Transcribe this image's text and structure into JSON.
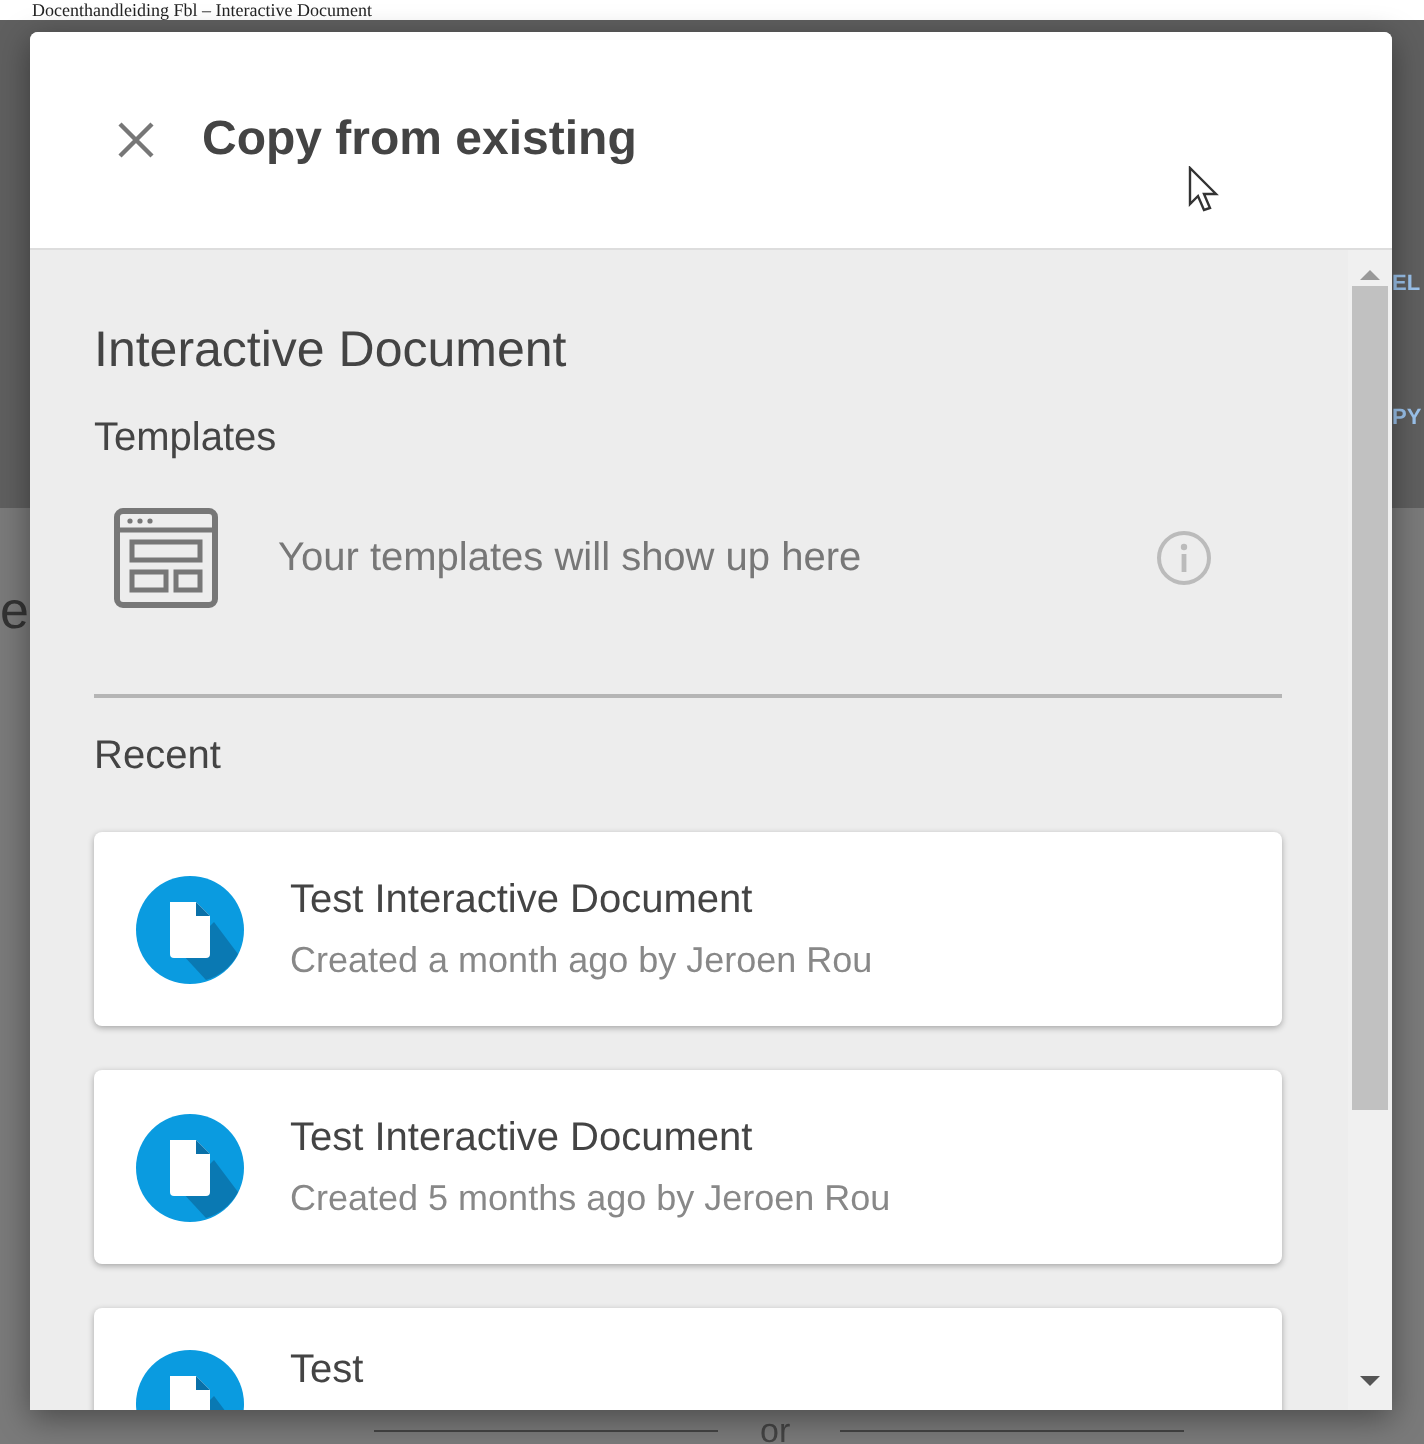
{
  "page_caption": "Docenthandleiding Fbl – Interactive Document",
  "background": {
    "right_labels": [
      "EL",
      "PY"
    ],
    "left_label": "e",
    "divider_label": "or"
  },
  "dialog": {
    "title": "Copy from existing",
    "section_title": "Interactive Document",
    "templates": {
      "heading": "Templates",
      "empty_message": "Your templates will show up here"
    },
    "recent": {
      "heading": "Recent",
      "items": [
        {
          "title": "Test Interactive Document",
          "subtitle": "Created a month ago by Jeroen Rou"
        },
        {
          "title": "Test Interactive Document",
          "subtitle": "Created 5 months ago by Jeroen Rou"
        },
        {
          "title": "Test"
        }
      ]
    }
  }
}
